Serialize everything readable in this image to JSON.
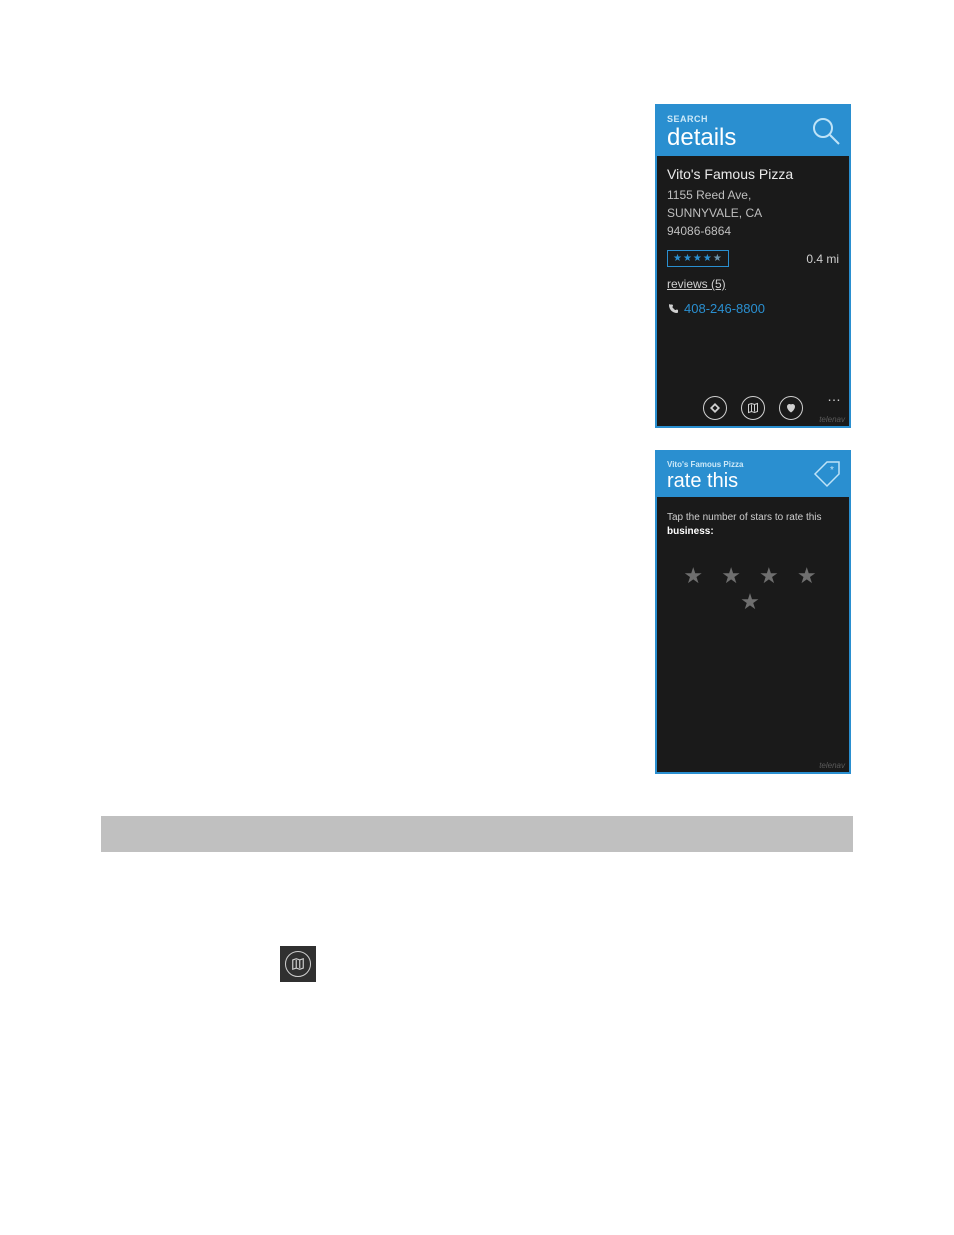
{
  "phone1": {
    "header_sub": "SEARCH",
    "header_title": "details",
    "biz_name": "Vito's Famous Pizza",
    "addr_line1": "1155 Reed Ave,",
    "addr_line2": "SUNNYVALE, CA",
    "addr_line3": "94086-6864",
    "rating_stars": "★★★★",
    "rating_dim": "★",
    "distance": "0.4 mi",
    "reviews_label": "reviews (5)",
    "phone_number": "408-246-8800",
    "ellipsis": "…",
    "watermark": "telenav"
  },
  "phone2": {
    "header_sub": "Vito's Famous Pizza",
    "header_title": "rate this",
    "prompt_a": "Tap the number of stars to rate this ",
    "prompt_b": "business:",
    "stars": "★ ★ ★ ★ ★",
    "watermark": "telenav"
  }
}
